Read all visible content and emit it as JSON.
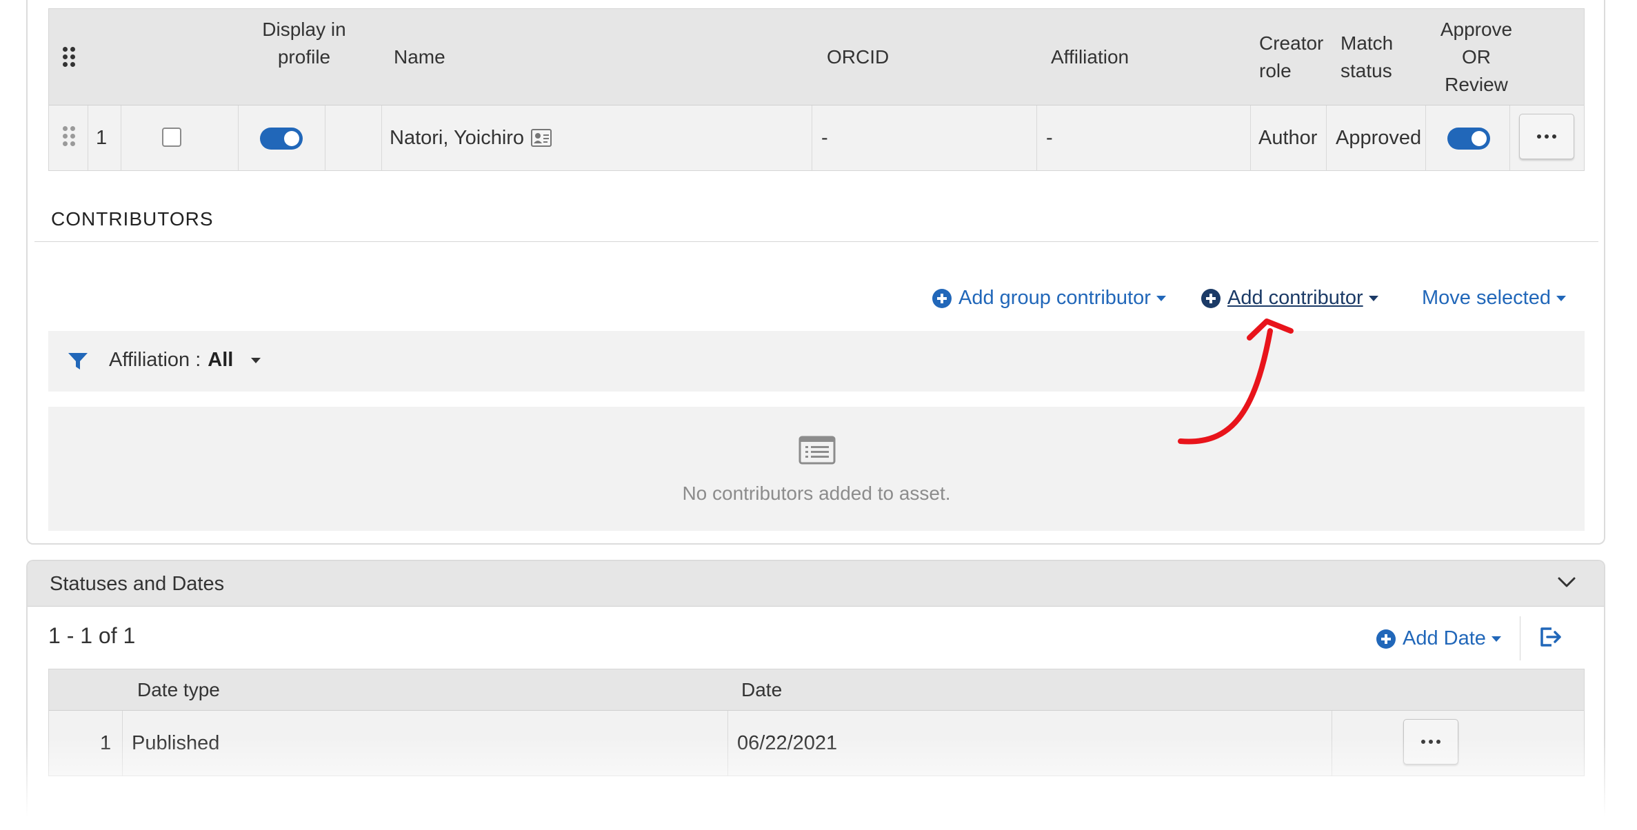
{
  "creators_table": {
    "headers": {
      "display_in_profile": "Display in profile",
      "name": "Name",
      "orcid": "ORCID",
      "affiliation": "Affiliation",
      "creator_role": "Creator role",
      "match_status": "Match status",
      "approve_or_review": "Approve OR Review"
    },
    "rows": [
      {
        "index": "1",
        "name": "Natori, Yoichiro",
        "orcid": "-",
        "affiliation": "-",
        "creator_role": "Author",
        "match_status": "Approved",
        "selected": false,
        "display_in_profile": true,
        "approved": true
      }
    ]
  },
  "contributors": {
    "section_title": "CONTRIBUTORS",
    "actions": {
      "add_group_contributor": "Add group contributor",
      "add_contributor": "Add contributor",
      "move_selected": "Move selected"
    },
    "filter": {
      "label": "Affiliation :",
      "value": "All"
    },
    "empty_message": "No contributors added to asset."
  },
  "statuses_and_dates": {
    "title": "Statuses and Dates",
    "count_text": "1 - 1 of 1",
    "add_date": "Add Date",
    "headers": {
      "date_type": "Date type",
      "date": "Date"
    },
    "rows": [
      {
        "index": "1",
        "date_type": "Published",
        "date": "06/22/2021"
      }
    ]
  },
  "colors": {
    "accent": "#2167b9",
    "annotation_arrow": "#e8141b",
    "header_bg": "#e6e6e6",
    "row_bg": "#f2f2f2"
  },
  "icons": [
    "drag-handle-icon",
    "contact-card-icon",
    "plus-circle-icon",
    "caret-down-icon",
    "filter-icon",
    "list-icon",
    "chevron-down-icon",
    "export-icon",
    "more-icon"
  ]
}
